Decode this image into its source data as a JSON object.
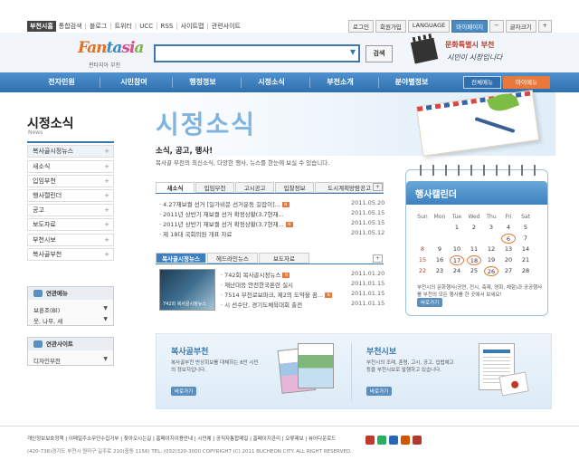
{
  "utility_left": {
    "items": [
      "부천시홈",
      "통합검색",
      "블로그",
      "트위터",
      "UCC",
      "RSS",
      "사이트맵",
      "관련사이트"
    ]
  },
  "utility_right": {
    "login": "로그인",
    "join": "회원가입",
    "language": "LANGUAGE",
    "mypage": "마이페이지",
    "font_minus": "−",
    "font_size": "글자크기",
    "font_plus": "+"
  },
  "logo": {
    "text": "Fantasia",
    "sub": "판타지아 부천"
  },
  "search": {
    "button": "검색",
    "placeholder": ""
  },
  "promo": {
    "line1": "문화특별시 부천",
    "line2": "시민이 시장입니다"
  },
  "nav": {
    "items": [
      "전자민원",
      "시민참여",
      "행정정보",
      "시정소식",
      "부천소개",
      "분야별정보"
    ],
    "all_menu": "전체메뉴",
    "my_menu": "마이메뉴"
  },
  "sidebar": {
    "title": "시정소식",
    "title_en": "News",
    "items": [
      "복사골시정뉴스",
      "새소식",
      "입임부천",
      "행사캘린더",
      "공고",
      "보도자료",
      "부천시보",
      "복사골부천"
    ],
    "related_menu": {
      "title": "연관메뉴",
      "items": [
        "보훈조(Bl)",
        "웃, 나무, 새"
      ]
    },
    "related_site": {
      "title": "연관사이트",
      "items": [
        "디자인부천"
      ]
    }
  },
  "main": {
    "title": "시정소식",
    "subtitle": "소식, 공고, 행사!",
    "description": "복사골 부천의 최신소식, 다양한 행사, 뉴스를 한눈에 보실 수 있습니다.",
    "tabs1": [
      "새소식",
      "입임부천",
      "고시공고",
      "입찰정보",
      "도시계획망람공고"
    ],
    "news1": [
      {
        "title": "4.27재보궐 선거 [일가비문 선거운동 길잡이]...",
        "date": "2011.05.20",
        "new": true
      },
      {
        "title": "2011년 상반기 재보궐 선거 확정상황(3.7현재...",
        "date": "2011.05.15",
        "new": false
      },
      {
        "title": "2011년 상반기 재보궐 선거 확정상황(3.7현재...",
        "date": "2011.05.15",
        "new": true
      },
      {
        "title": "제 18대 국회의원 개표 자료",
        "date": "2011.05.12",
        "new": false
      }
    ],
    "tabs2": [
      "복사골시정뉴스",
      "헤드라인뉴스",
      "보도자료"
    ],
    "news2": [
      {
        "title": "742회 복사골시정뉴스",
        "date": "2011.01.20",
        "new": true
      },
      {
        "title": "재난대응 안전한국훈련 실시",
        "date": "2011.01.15",
        "new": false
      },
      {
        "title": "7514 부천로보파크, 제2의 도약을 꿈...",
        "date": "2011.01.15",
        "new": true
      },
      {
        "title": "시 선수단, 경기도체육대회 출전",
        "date": "2011.01.15",
        "new": false
      }
    ],
    "thumb_caption": "742회 복사골시정뉴스"
  },
  "calendar": {
    "title": "행사캘린더",
    "weekdays": [
      "Sun",
      "Mon",
      "Tue",
      "Wed",
      "Thu",
      "Fri",
      "Sat"
    ],
    "weeks": [
      [
        "",
        "",
        "1",
        "2",
        "3",
        "4",
        "5"
      ],
      [
        "",
        "",
        "",
        "",
        "",
        "6",
        "7"
      ],
      [
        "8",
        "9",
        "10",
        "11",
        "12",
        "13",
        "14"
      ],
      [
        "15",
        "16",
        "17",
        "18",
        "19",
        "20",
        "21"
      ],
      [
        "22",
        "23",
        "24",
        "25",
        "26",
        "27",
        "28"
      ]
    ],
    "highlighted": [
      "6",
      "17",
      "18",
      "26"
    ],
    "note": "부천시의 문화행사(공연, 전시, 축제, 영화, 체험)과 공공행사를 부천의 모든 행사를 한 곳에서 보세요!",
    "more": "바로가기"
  },
  "banners": {
    "b1_title": "복사골부천",
    "b1_desc": "복사골부천 반상회보를 대체하는 8만 시민의 정보지입니다.",
    "b1_more": "바로가기",
    "b2_title": "부천시보",
    "b2_desc": "부천시의 조례, 훈령, 고시, 공고, 입법예고 등을 부천시보로 발행하고 있습니다.",
    "b2_more": "바로가기"
  },
  "footer": {
    "links": "개인정보보호정책 | 이메일주소무단수집거부 | 찾아오시는길 | 홈페이지이용안내 | 시민예 | 공직자통합메일 | 홈페이지관리 | 오류제보 | 뷰어다운로드",
    "address": "(420-736)경기도 부천시 원미구 길주로 210(중동 1156)  TEL: (032)320-3000  COPYRIGHT (C) 2011 BUCHEON CITY. ALL RIGHT RESERVED."
  },
  "colors": {
    "nav": "#3d7fbf",
    "accent": "#e8793a",
    "title": "#7fb4e0"
  }
}
